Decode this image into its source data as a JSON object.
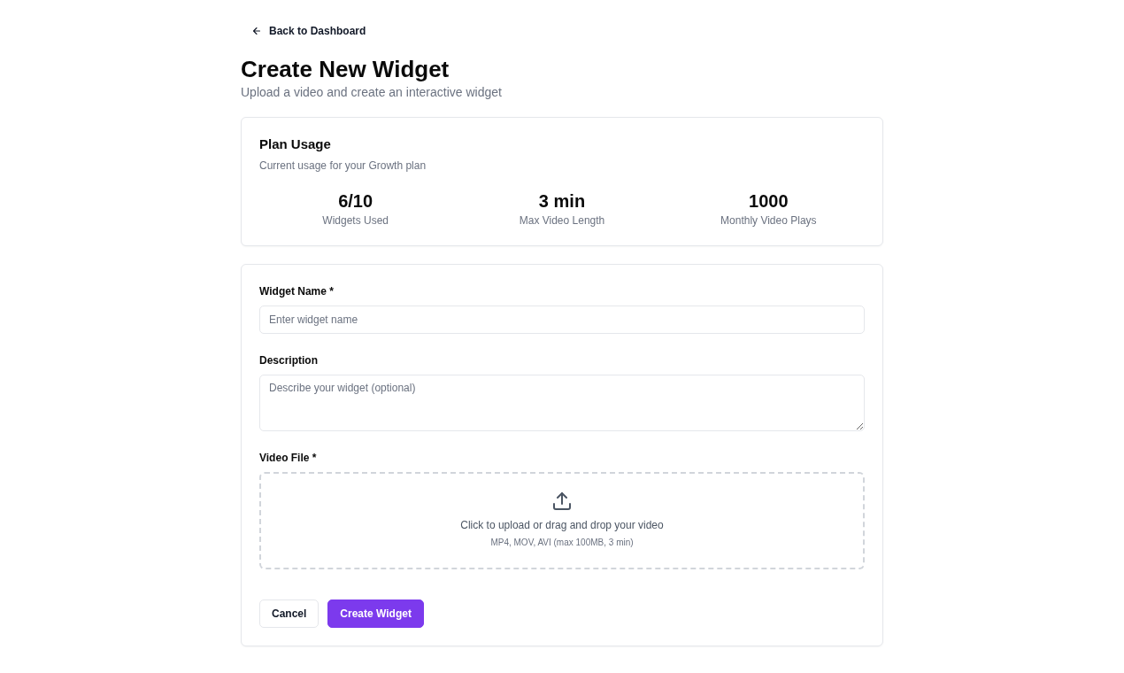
{
  "back_link": {
    "label": "Back to Dashboard"
  },
  "header": {
    "title": "Create New Widget",
    "subtitle": "Upload a video and create an interactive widget"
  },
  "plan_usage": {
    "title": "Plan Usage",
    "description": "Current usage for your Growth plan",
    "stats": [
      {
        "value": "6/10",
        "label": "Widgets Used"
      },
      {
        "value": "3 min",
        "label": "Max Video Length"
      },
      {
        "value": "1000",
        "label": "Monthly Video Plays"
      }
    ]
  },
  "form": {
    "fields": [
      {
        "kind": "text",
        "label": "Widget Name *",
        "placeholder": "Enter widget name"
      },
      {
        "kind": "textarea",
        "label": "Description",
        "placeholder": "Describe your widget (optional)"
      },
      {
        "kind": "upload",
        "label": "Video File *",
        "prompt": "Click to upload or drag and drop your video",
        "hint": "MP4, MOV, AVI (max 100MB, 3 min)"
      }
    ],
    "buttons": [
      {
        "kind": "secondary",
        "label": "Cancel"
      },
      {
        "kind": "primary",
        "label": "Create Widget"
      }
    ]
  }
}
